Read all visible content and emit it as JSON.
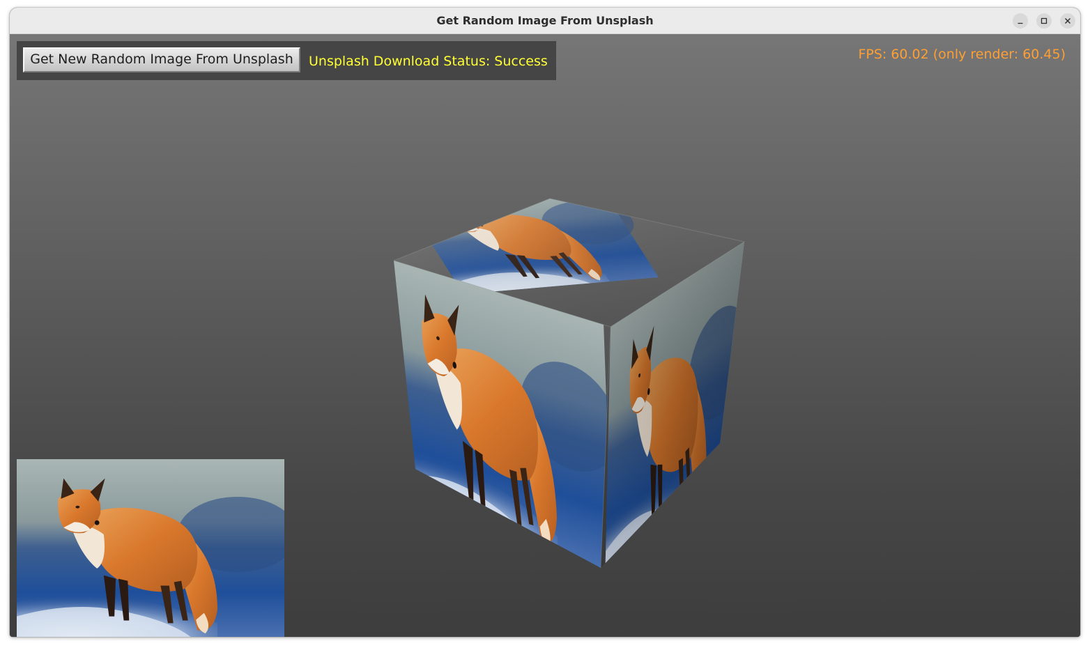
{
  "window": {
    "title": "Get Random Image From Unsplash",
    "controls": [
      "minimize-icon",
      "maximize-icon",
      "close-icon"
    ]
  },
  "toolbar": {
    "fetch_button_label": "Get New Random Image From Unsplash",
    "status_text": "Unsplash Download Status: Success"
  },
  "hud": {
    "fps_text": "FPS: 60.02 (only render: 60.45)"
  },
  "colors": {
    "status": "#ffff33",
    "fps": "#ff9f33",
    "background_top": "#767676",
    "background_bottom": "#3d3d3d"
  }
}
